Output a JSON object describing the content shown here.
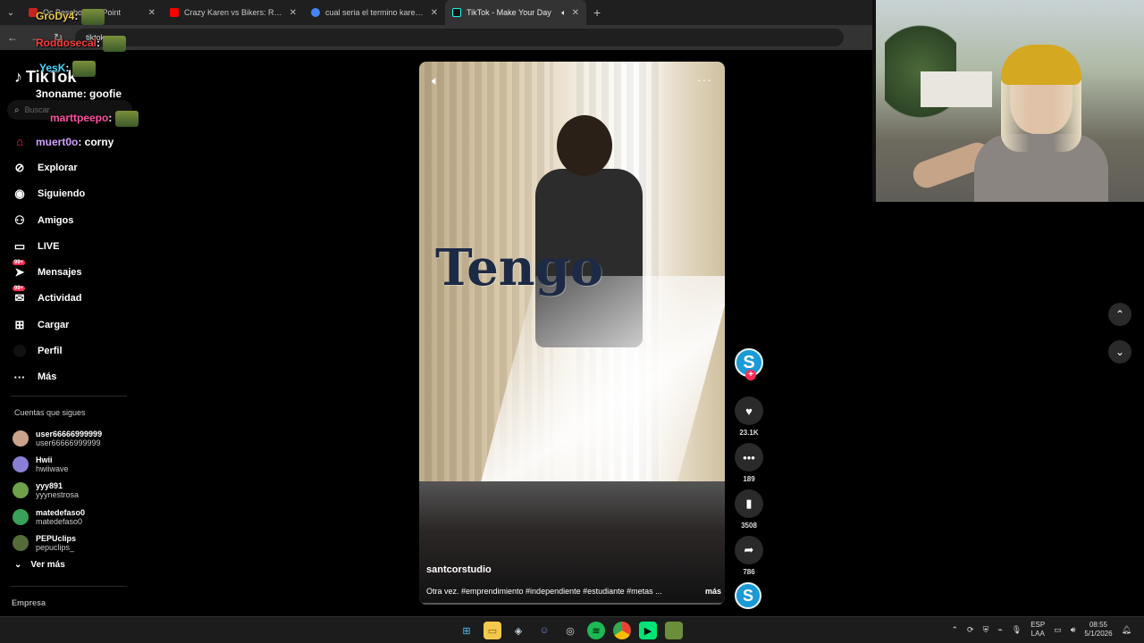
{
  "browser": {
    "tabs": [
      {
        "title": "Oc Bescho... ng Point",
        "color": "#cc2222",
        "active": false
      },
      {
        "title": "Crazy Karen vs Bikers: Road Rag",
        "color": "#ff0000",
        "active": false
      },
      {
        "title": "cual seria el termino karen en e",
        "color": "#4285f4",
        "active": false
      },
      {
        "title": "TikTok - Make Your Day",
        "color": "#000000",
        "active": true
      }
    ],
    "url": "tiktok.com",
    "new_tab": "+",
    "close": "✕"
  },
  "tiktok": {
    "logo": "TikTok",
    "search_placeholder": "Buscar",
    "nav": [
      {
        "label": "Explorar",
        "icon": "compass-icon"
      },
      {
        "label": "Siguiendo",
        "icon": "following-icon"
      },
      {
        "label": "Amigos",
        "icon": "friends-icon"
      },
      {
        "label": "LIVE",
        "icon": "live-icon"
      },
      {
        "label": "Mensajes",
        "icon": "messages-icon",
        "badge": "99+"
      },
      {
        "label": "Actividad",
        "icon": "activity-icon",
        "badge": "99+"
      },
      {
        "label": "Cargar",
        "icon": "upload-icon"
      },
      {
        "label": "Perfil",
        "icon": "profile-icon"
      },
      {
        "label": "Más",
        "icon": "more-icon"
      }
    ],
    "following_header": "Cuentas que sigues",
    "following": [
      {
        "name": "user66666999999",
        "handle": "user66666999999",
        "color": "#c9a48c"
      },
      {
        "name": "Hwii",
        "handle": "hwiiwave",
        "color": "#8a7fd6"
      },
      {
        "name": "yyy891",
        "handle": "yyynestrosa",
        "color": "#6fa04a"
      },
      {
        "name": "matedefaso0",
        "handle": "matedefaso0",
        "color": "#3aa05a"
      },
      {
        "name": "PEPUclips",
        "handle": "pepuclips_",
        "color": "#556b3a"
      }
    ],
    "ver_mas": "Ver más",
    "empresa": "Empresa"
  },
  "chat": [
    {
      "user": "GroDy4",
      "text": ":",
      "color": "#e8c84a"
    },
    {
      "user": "Roddosecal",
      "text": ":",
      "color": "#ff3b3b"
    },
    {
      "user": "YesK",
      "text": ":",
      "color": "#4ad4ff"
    },
    {
      "user": "3noname",
      "text": ": goofie",
      "color": "#ffffff"
    },
    {
      "user": "marttpeepo",
      "text": ":",
      "color": "#ff4fa0"
    },
    {
      "user": "muert0o",
      "text": ": corny",
      "color": "#d0a0ff"
    }
  ],
  "video": {
    "overlay_text": "Tengo",
    "author": "santcorstudio",
    "caption": "Otra vez. #emprendimiento #independiente #estudiante #metas ...",
    "more": "más",
    "avatar_letter": "S"
  },
  "actions": {
    "likes": "23.1K",
    "comments": "189",
    "saves": "3508",
    "shares": "786"
  },
  "taskbar": {
    "lang_top": "ESP",
    "lang_bottom": "LAA",
    "time": "08:55",
    "date": "5/1/2026"
  }
}
